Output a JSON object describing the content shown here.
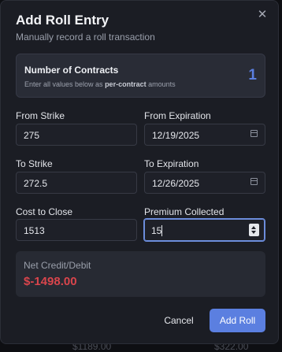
{
  "modal": {
    "title": "Add Roll Entry",
    "subtitle": "Manually record a roll transaction",
    "close_icon": "close-icon"
  },
  "contracts": {
    "title": "Number of Contracts",
    "hint_prefix": "Enter all values below as ",
    "hint_bold": "per-contract",
    "hint_suffix": " amounts",
    "value": "1"
  },
  "form": {
    "from_strike": {
      "label": "From Strike",
      "value": "275"
    },
    "from_expiration": {
      "label": "From Expiration",
      "value": "12/19/2025"
    },
    "to_strike": {
      "label": "To Strike",
      "value": "272.5"
    },
    "to_expiration": {
      "label": "To Expiration",
      "value": "12/26/2025"
    },
    "cost_to_close": {
      "label": "Cost to Close",
      "value": "1513"
    },
    "premium_collected": {
      "label": "Premium Collected",
      "value": "15"
    }
  },
  "net": {
    "label": "Net Credit/Debit",
    "value": "$-1498.00",
    "color": "#d9454c"
  },
  "buttons": {
    "cancel": "Cancel",
    "add_roll": "Add Roll"
  },
  "background": {
    "left_value": "$1189.00",
    "right_value": "$322.00"
  },
  "colors": {
    "accent": "#5b7fe0",
    "negative": "#d9454c",
    "modal_bg": "#1b1d24"
  }
}
